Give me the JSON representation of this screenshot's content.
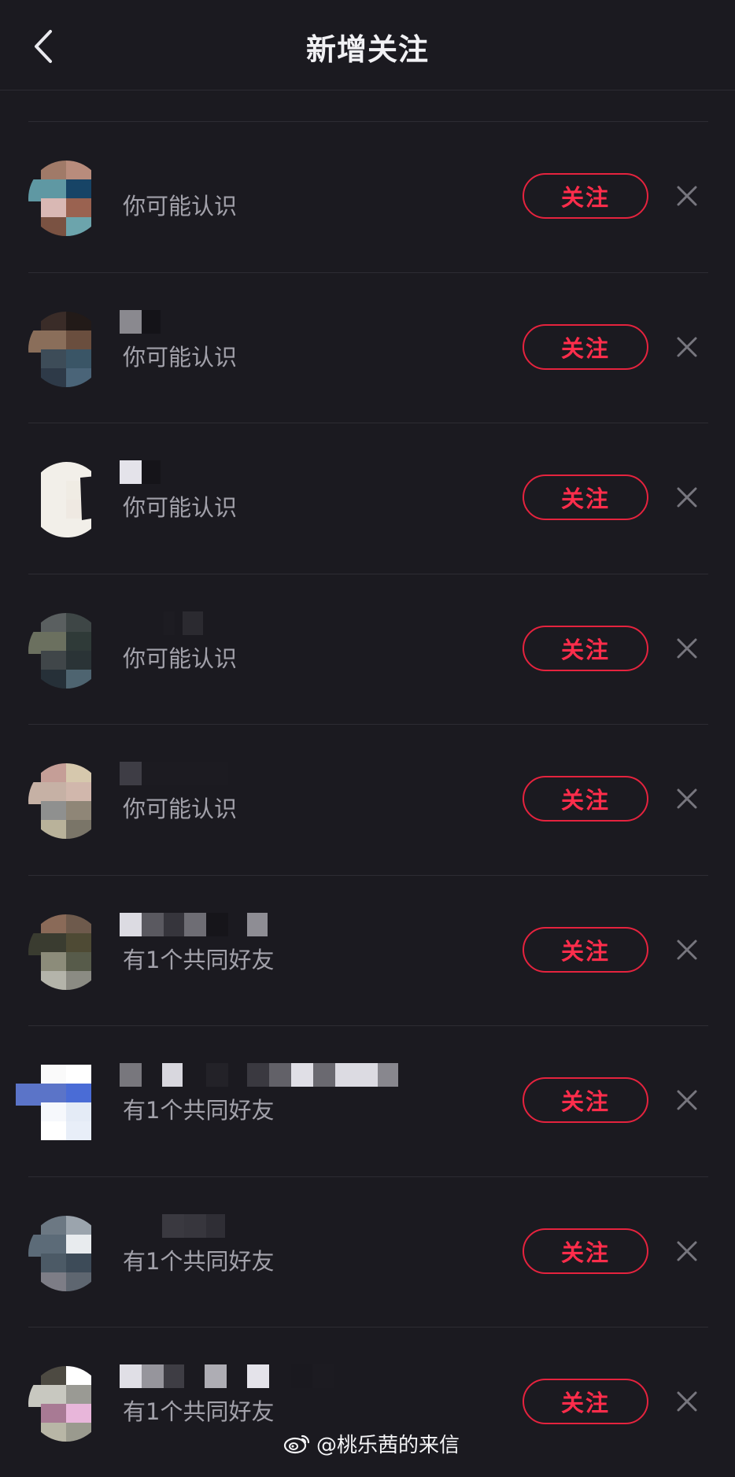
{
  "header": {
    "title": "新增关注",
    "back_icon": "chevron-left-icon"
  },
  "rows": [
    {
      "subtitle": "你可能认识",
      "follow_label": "关注",
      "close_icon": "close-icon"
    },
    {
      "subtitle": "你可能认识",
      "follow_label": "关注",
      "close_icon": "close-icon"
    },
    {
      "subtitle": "你可能认识",
      "follow_label": "关注",
      "close_icon": "close-icon"
    },
    {
      "subtitle": "你可能认识",
      "follow_label": "关注",
      "close_icon": "close-icon"
    },
    {
      "subtitle": "你可能认识",
      "follow_label": "关注",
      "close_icon": "close-icon"
    },
    {
      "subtitle": "有1个共同好友",
      "follow_label": "关注",
      "close_icon": "close-icon"
    },
    {
      "subtitle": "有1个共同好友",
      "follow_label": "关注",
      "close_icon": "close-icon"
    },
    {
      "subtitle": "有1个共同好友",
      "follow_label": "关注",
      "close_icon": "close-icon"
    },
    {
      "subtitle": "有1个共同好友",
      "follow_label": "关注",
      "close_icon": "close-icon"
    }
  ],
  "watermark": {
    "text": "@桃乐茜的来信",
    "icon": "weibo-icon"
  },
  "colors": {
    "background": "#1b1a20",
    "accent": "#ff2d4b",
    "accent_border": "#e5233e",
    "subtitle": "#a2a1aa"
  }
}
